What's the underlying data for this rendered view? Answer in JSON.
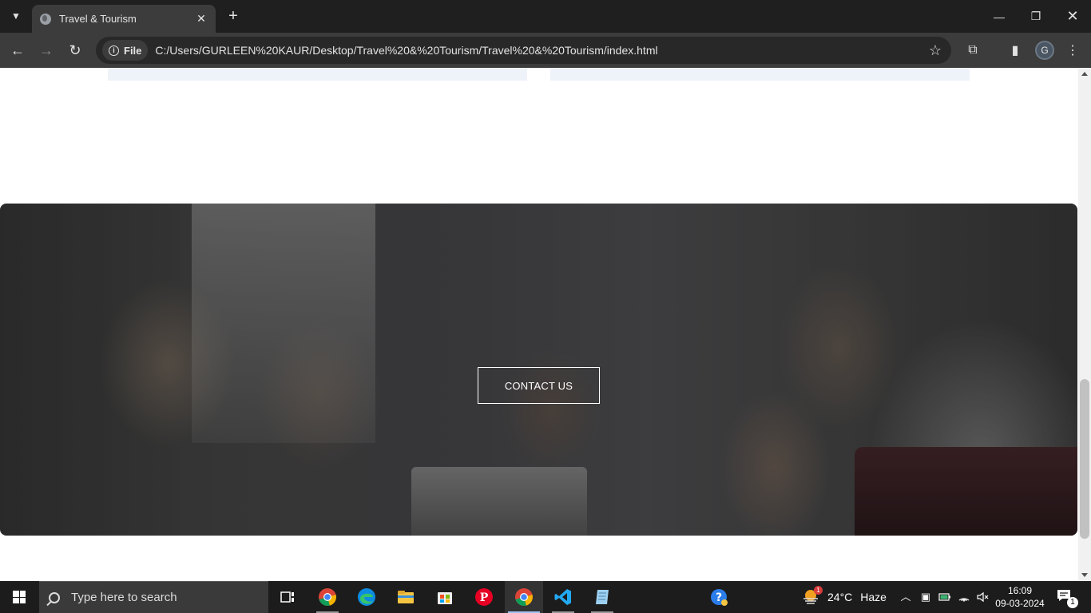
{
  "browser": {
    "tab_title": "Travel & Tourism",
    "chip_label": "File",
    "url": "C:/Users/GURLEEN%20KAUR/Desktop/Travel%20&%20Tourism/Travel%20&%20Tourism/index.html",
    "profile_initial": "G"
  },
  "page": {
    "cta_button": "CONTACT US"
  },
  "taskbar": {
    "search_placeholder": "Type here to search",
    "weather_temp": "24°C",
    "weather_desc": "Haze",
    "time": "16:09",
    "date": "09-03-2024",
    "notification_count": "1",
    "weather_badge": "1"
  },
  "colors": {
    "titlebar": "#1f1f1f",
    "toolbar": "#3c3c3c",
    "taskbar": "#1c1c1c",
    "card_background": "#eef2f9"
  }
}
